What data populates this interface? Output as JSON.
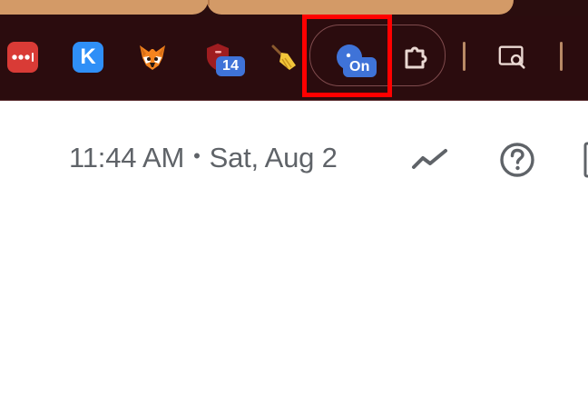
{
  "toolbar": {
    "extensions": [
      {
        "name": "lastpass-extension",
        "icon": "dots-bar-icon",
        "color": "#d93b36"
      },
      {
        "name": "k-extension",
        "icon": "k-logo-icon",
        "text": "K",
        "color": "#2b8ff7"
      },
      {
        "name": "metamask-extension",
        "icon": "fox-icon",
        "color": "#f5841f"
      },
      {
        "name": "shield-extension",
        "icon": "shield-icon",
        "badge": "14",
        "color": "#9f1d20"
      },
      {
        "name": "broom-extension",
        "icon": "broom-icon",
        "color": "#f0c030"
      },
      {
        "name": "pinned-extension",
        "icon": "circle-badge-icon",
        "badge": "On",
        "color": "#3f73d8"
      }
    ],
    "extensions_puzzle_icon": "puzzle-icon",
    "media_search_icon": "search-document-icon",
    "highlight_color": "#ff0000"
  },
  "status": {
    "time": "11:44 AM",
    "separator": "•",
    "date": "Sat, Aug 2"
  },
  "actions": {
    "activity_icon": "trend-line-icon",
    "help_icon": "help-circle-icon",
    "edge_icon": "panel-icon"
  }
}
